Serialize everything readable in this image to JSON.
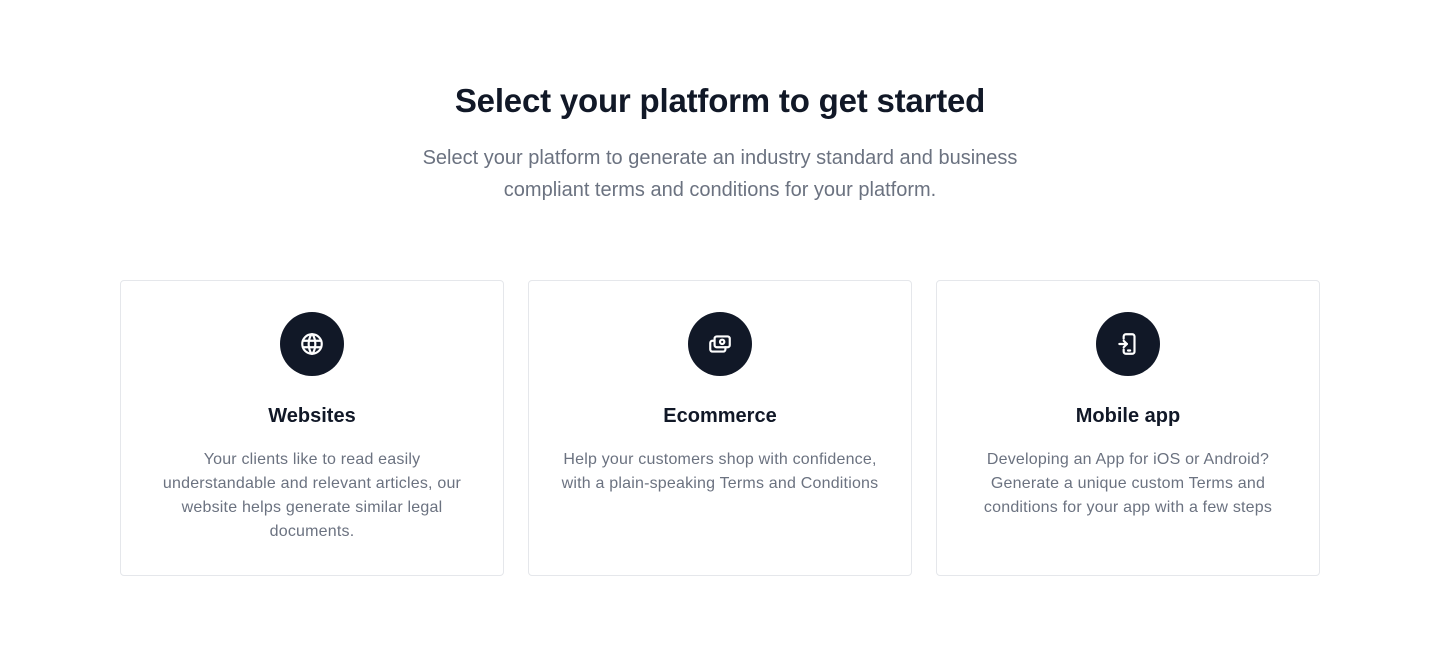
{
  "header": {
    "title": "Select your platform to get started",
    "subtitle": "Select your platform to generate an industry standard and business compliant terms and conditions for your platform."
  },
  "cards": [
    {
      "icon": "globe-icon",
      "title": "Websites",
      "description": "Your clients like to read easily understandable and relevant articles, our website helps generate similar legal documents."
    },
    {
      "icon": "cash-icon",
      "title": "Ecommerce",
      "description": "Help your customers shop with confidence, with a plain-speaking Terms and Conditions"
    },
    {
      "icon": "mobile-phone-icon",
      "title": "Mobile app",
      "description": "Developing an App for iOS or Android? Generate a unique custom Terms and conditions for your app with a few steps"
    }
  ],
  "colors": {
    "icon_background": "#111827",
    "heading": "#111827",
    "body_text": "#6b7280",
    "card_border": "#e5e7eb"
  }
}
